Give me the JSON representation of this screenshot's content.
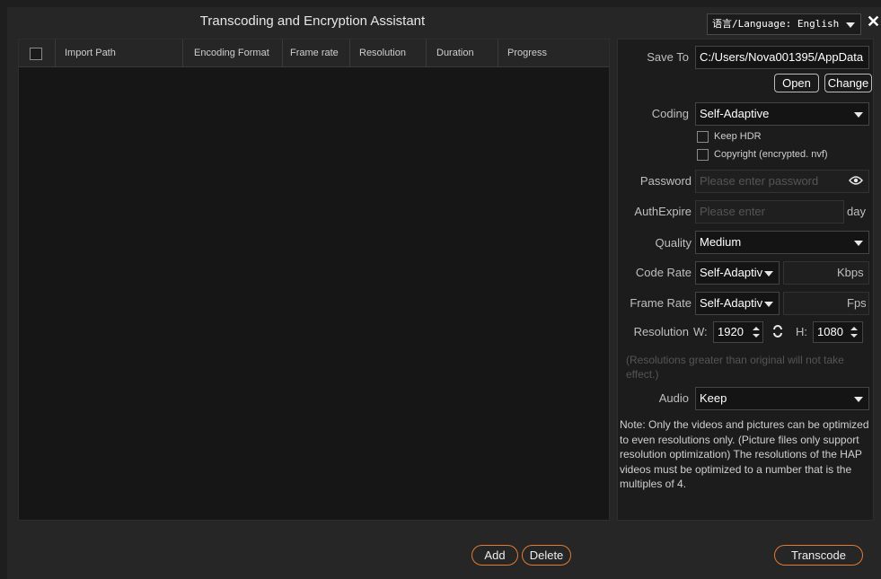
{
  "window": {
    "title": "Transcoding and Encryption Assistant",
    "language_select": "语言/Language: English",
    "close_glyph": "✕"
  },
  "table": {
    "columns": [
      "Import Path",
      "Encoding Format",
      "Frame rate",
      "Resolution",
      "Duration",
      "Progress"
    ],
    "rows": []
  },
  "settings": {
    "save_to_label": "Save To",
    "save_to_value": "C:/Users/Nova001395/AppData",
    "open_label": "Open",
    "change_label": "Change",
    "coding_label": "Coding",
    "coding_value": "Self-Adaptive",
    "keep_hdr_label": "Keep HDR",
    "keep_hdr_checked": false,
    "copyright_label": "Copyright (encrypted. nvf)",
    "copyright_checked": false,
    "password_label": "Password",
    "password_placeholder": "Please enter password",
    "auth_expire_label": "AuthExpire",
    "auth_expire_placeholder": "Please enter",
    "auth_expire_unit": "day",
    "quality_label": "Quality",
    "quality_value": "Medium",
    "code_rate_label": "Code Rate",
    "code_rate_value": "Self-Adaptiv",
    "code_rate_unit": "Kbps",
    "frame_rate_label": "Frame Rate",
    "frame_rate_value": "Self-Adaptiv",
    "frame_rate_unit": "Fps",
    "resolution_label": "Resolution",
    "width_label": "W:",
    "width_value": "1920",
    "height_label": "H:",
    "height_value": "1080",
    "resolution_note": "(Resolutions greater than original will not take effect.)",
    "audio_label": "Audio",
    "audio_value": "Keep",
    "note": "Note: Only the videos and pictures can be optimized to even resolutions only. (Picture files only support resolution optimization) The resolutions of the HAP videos must be optimized to a number that is the multiples of 4."
  },
  "footer": {
    "add_label": "Add",
    "delete_label": "Delete",
    "transcode_label": "Transcode"
  },
  "colors": {
    "accent": "#e07a34",
    "background": "#262626",
    "table_body": "#161616"
  }
}
